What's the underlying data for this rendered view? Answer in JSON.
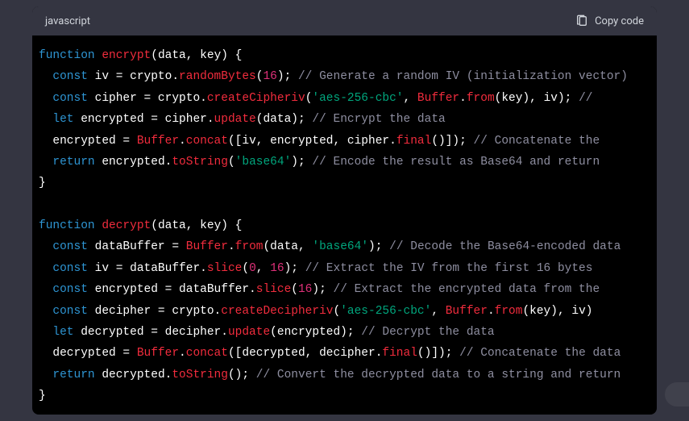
{
  "header": {
    "language": "javascript",
    "copy_label": "Copy code"
  },
  "code": {
    "lines": [
      [
        {
          "c": "tok-k",
          "t": "function"
        },
        {
          "c": "tok-p",
          "t": " "
        },
        {
          "c": "tok-fn",
          "t": "encrypt"
        },
        {
          "c": "tok-p",
          "t": "(data, key) {"
        }
      ],
      [
        {
          "c": "tok-p",
          "t": "  "
        },
        {
          "c": "tok-k",
          "t": "const"
        },
        {
          "c": "tok-p",
          "t": " iv = crypto."
        },
        {
          "c": "tok-fn",
          "t": "randomBytes"
        },
        {
          "c": "tok-p",
          "t": "("
        },
        {
          "c": "tok-n",
          "t": "16"
        },
        {
          "c": "tok-p",
          "t": "); "
        },
        {
          "c": "tok-c",
          "t": "// Generate a random IV (initialization vector)"
        }
      ],
      [
        {
          "c": "tok-p",
          "t": "  "
        },
        {
          "c": "tok-k",
          "t": "const"
        },
        {
          "c": "tok-p",
          "t": " cipher = crypto."
        },
        {
          "c": "tok-fn",
          "t": "createCipheriv"
        },
        {
          "c": "tok-p",
          "t": "("
        },
        {
          "c": "tok-s",
          "t": "'aes-256-cbc'"
        },
        {
          "c": "tok-p",
          "t": ", "
        },
        {
          "c": "tok-fn",
          "t": "Buffer"
        },
        {
          "c": "tok-p",
          "t": "."
        },
        {
          "c": "tok-fn",
          "t": "from"
        },
        {
          "c": "tok-p",
          "t": "(key), iv); "
        },
        {
          "c": "tok-c",
          "t": "//"
        }
      ],
      [
        {
          "c": "tok-p",
          "t": "  "
        },
        {
          "c": "tok-k",
          "t": "let"
        },
        {
          "c": "tok-p",
          "t": " encrypted = cipher."
        },
        {
          "c": "tok-fn",
          "t": "update"
        },
        {
          "c": "tok-p",
          "t": "(data); "
        },
        {
          "c": "tok-c",
          "t": "// Encrypt the data"
        }
      ],
      [
        {
          "c": "tok-p",
          "t": "  encrypted = "
        },
        {
          "c": "tok-fn",
          "t": "Buffer"
        },
        {
          "c": "tok-p",
          "t": "."
        },
        {
          "c": "tok-fn",
          "t": "concat"
        },
        {
          "c": "tok-p",
          "t": "([iv, encrypted, cipher."
        },
        {
          "c": "tok-fn",
          "t": "final"
        },
        {
          "c": "tok-p",
          "t": "()]); "
        },
        {
          "c": "tok-c",
          "t": "// Concatenate the"
        }
      ],
      [
        {
          "c": "tok-p",
          "t": "  "
        },
        {
          "c": "tok-k",
          "t": "return"
        },
        {
          "c": "tok-p",
          "t": " encrypted."
        },
        {
          "c": "tok-fn",
          "t": "toString"
        },
        {
          "c": "tok-p",
          "t": "("
        },
        {
          "c": "tok-s",
          "t": "'base64'"
        },
        {
          "c": "tok-p",
          "t": "); "
        },
        {
          "c": "tok-c",
          "t": "// Encode the result as Base64 and return"
        }
      ],
      [
        {
          "c": "tok-p",
          "t": "}"
        }
      ],
      [
        {
          "c": "tok-p",
          "t": ""
        }
      ],
      [
        {
          "c": "tok-k",
          "t": "function"
        },
        {
          "c": "tok-p",
          "t": " "
        },
        {
          "c": "tok-fn",
          "t": "decrypt"
        },
        {
          "c": "tok-p",
          "t": "(data, key) {"
        }
      ],
      [
        {
          "c": "tok-p",
          "t": "  "
        },
        {
          "c": "tok-k",
          "t": "const"
        },
        {
          "c": "tok-p",
          "t": " dataBuffer = "
        },
        {
          "c": "tok-fn",
          "t": "Buffer"
        },
        {
          "c": "tok-p",
          "t": "."
        },
        {
          "c": "tok-fn",
          "t": "from"
        },
        {
          "c": "tok-p",
          "t": "(data, "
        },
        {
          "c": "tok-s",
          "t": "'base64'"
        },
        {
          "c": "tok-p",
          "t": "); "
        },
        {
          "c": "tok-c",
          "t": "// Decode the Base64-encoded data"
        }
      ],
      [
        {
          "c": "tok-p",
          "t": "  "
        },
        {
          "c": "tok-k",
          "t": "const"
        },
        {
          "c": "tok-p",
          "t": " iv = dataBuffer."
        },
        {
          "c": "tok-fn",
          "t": "slice"
        },
        {
          "c": "tok-p",
          "t": "("
        },
        {
          "c": "tok-n",
          "t": "0"
        },
        {
          "c": "tok-p",
          "t": ", "
        },
        {
          "c": "tok-n",
          "t": "16"
        },
        {
          "c": "tok-p",
          "t": "); "
        },
        {
          "c": "tok-c",
          "t": "// Extract the IV from the first 16 bytes"
        }
      ],
      [
        {
          "c": "tok-p",
          "t": "  "
        },
        {
          "c": "tok-k",
          "t": "const"
        },
        {
          "c": "tok-p",
          "t": " encrypted = dataBuffer."
        },
        {
          "c": "tok-fn",
          "t": "slice"
        },
        {
          "c": "tok-p",
          "t": "("
        },
        {
          "c": "tok-n",
          "t": "16"
        },
        {
          "c": "tok-p",
          "t": "); "
        },
        {
          "c": "tok-c",
          "t": "// Extract the encrypted data from the"
        }
      ],
      [
        {
          "c": "tok-p",
          "t": "  "
        },
        {
          "c": "tok-k",
          "t": "const"
        },
        {
          "c": "tok-p",
          "t": " decipher = crypto."
        },
        {
          "c": "tok-fn",
          "t": "createDecipheriv"
        },
        {
          "c": "tok-p",
          "t": "("
        },
        {
          "c": "tok-s",
          "t": "'aes-256-cbc'"
        },
        {
          "c": "tok-p",
          "t": ", "
        },
        {
          "c": "tok-fn",
          "t": "Buffer"
        },
        {
          "c": "tok-p",
          "t": "."
        },
        {
          "c": "tok-fn",
          "t": "from"
        },
        {
          "c": "tok-p",
          "t": "(key), iv)"
        }
      ],
      [
        {
          "c": "tok-p",
          "t": "  "
        },
        {
          "c": "tok-k",
          "t": "let"
        },
        {
          "c": "tok-p",
          "t": " decrypted = decipher."
        },
        {
          "c": "tok-fn",
          "t": "update"
        },
        {
          "c": "tok-p",
          "t": "(encrypted); "
        },
        {
          "c": "tok-c",
          "t": "// Decrypt the data"
        }
      ],
      [
        {
          "c": "tok-p",
          "t": "  decrypted = "
        },
        {
          "c": "tok-fn",
          "t": "Buffer"
        },
        {
          "c": "tok-p",
          "t": "."
        },
        {
          "c": "tok-fn",
          "t": "concat"
        },
        {
          "c": "tok-p",
          "t": "([decrypted, decipher."
        },
        {
          "c": "tok-fn",
          "t": "final"
        },
        {
          "c": "tok-p",
          "t": "()]); "
        },
        {
          "c": "tok-c",
          "t": "// Concatenate the data"
        }
      ],
      [
        {
          "c": "tok-p",
          "t": "  "
        },
        {
          "c": "tok-k",
          "t": "return"
        },
        {
          "c": "tok-p",
          "t": " decrypted."
        },
        {
          "c": "tok-fn",
          "t": "toString"
        },
        {
          "c": "tok-p",
          "t": "(); "
        },
        {
          "c": "tok-c",
          "t": "// Convert the decrypted data to a string and return"
        }
      ],
      [
        {
          "c": "tok-p",
          "t": "}"
        }
      ]
    ]
  }
}
